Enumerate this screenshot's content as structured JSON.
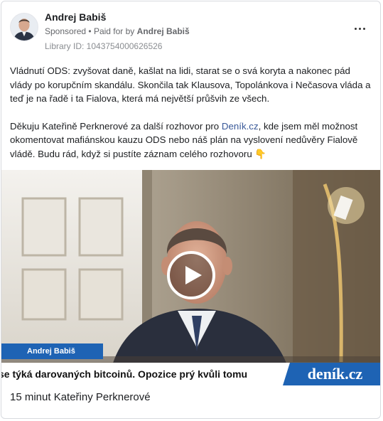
{
  "post": {
    "author": "Andrej Babiš",
    "sponsored_label": "Sponsored",
    "separator": "•",
    "paid_for_prefix": "Paid for by",
    "paid_for_by": "Andrej Babiš",
    "library_id": "Library ID: 1043754000626526",
    "paragraph1": "Vládnutí ODS: zvyšovat daně, kašlat na lidi, starat se o svá koryta a nakonec pád vlády po korupčním skandálu. Skončila tak Klausova, Topolánkova i Nečasova vláda a teď je na řadě i ta Fialova, která má největší průšvih ze všech.",
    "paragraph2_before_link": "Děkuju Kateřině Perknerové za další rozhovor pro ",
    "paragraph2_link": "Deník.cz",
    "paragraph2_after_link": ", kde jsem měl možnost okomentovat mafiánskou kauzu ODS nebo náš plán na vyslovení nedůvěry Fialově vládě. Budu rád, když si pustíte záznam celého rozhovoru 👇"
  },
  "video": {
    "name_tag": "Andrej Babiš",
    "ticker_text": "se týká darovaných bitcoinů. Opozice prý kvůli tomu",
    "ticker_brand": "deník.cz",
    "play_icon": "play-icon"
  },
  "caption": "15 minut Kateřiny Perknerové",
  "icons": {
    "more": "more-options-icon",
    "avatar": "avatar"
  },
  "colors": {
    "link": "#385898",
    "brand_blue": "#1e63b4",
    "secondary_text": "#65676b"
  }
}
